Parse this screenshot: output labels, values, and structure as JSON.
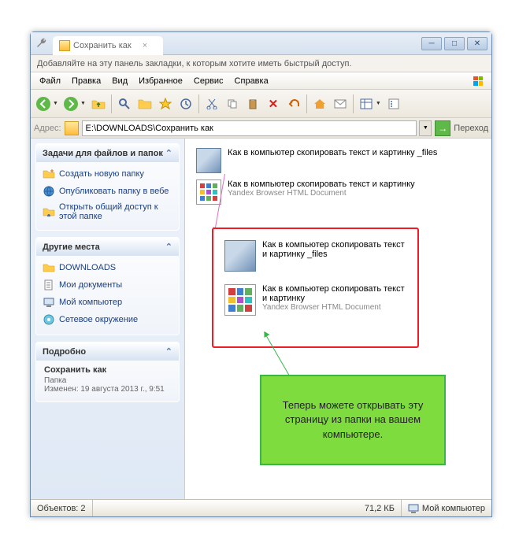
{
  "tab": {
    "title": "Сохранить как",
    "close": "×"
  },
  "titlebuttons": {
    "min": "─",
    "max": "□",
    "close": "✕"
  },
  "bookmarkbar": {
    "text": "Добавляйте на эту панель закладки, к которым хотите иметь быстрый доступ."
  },
  "menu": {
    "file": "Файл",
    "edit": "Правка",
    "view": "Вид",
    "favorites": "Избранное",
    "tools": "Сервис",
    "help": "Справка"
  },
  "address": {
    "label": "Адрес:",
    "value": "E:\\DOWNLOADS\\Сохранить как",
    "go": "Переход"
  },
  "sidebar": {
    "tasks": {
      "title": "Задачи для файлов и папок",
      "items": [
        "Создать новую папку",
        "Опубликовать папку в вебе",
        "Открыть общий доступ к этой папке"
      ]
    },
    "places": {
      "title": "Другие места",
      "items": [
        "DOWNLOADS",
        "Мои документы",
        "Мой компьютер",
        "Сетевое окружение"
      ]
    },
    "details": {
      "title": "Подробно",
      "name": "Сохранить как",
      "type": "Папка",
      "modified": "Изменен: 19 августа 2013 г., 9:51"
    }
  },
  "files": {
    "folder": {
      "name": "Как в компьютер скопировать текст и картинку _files"
    },
    "html": {
      "name": "Как в компьютер скопировать текст и картинку",
      "type": "Yandex Browser HTML Document"
    }
  },
  "callout": {
    "text": "Теперь можете открывать эту страницу из папки на вашем компьютере."
  },
  "statusbar": {
    "objects": "Объектов: 2",
    "size": "71,2 КБ",
    "location": "Мой компьютер"
  }
}
